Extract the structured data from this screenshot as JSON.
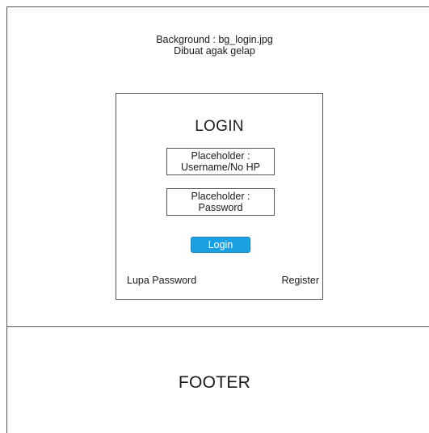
{
  "background_note": {
    "line1": "Background : bg_login.jpg",
    "line2": "Dibuat agak gelap"
  },
  "login": {
    "title": "LOGIN",
    "username_field": {
      "line1": "Placeholder :",
      "line2": "Username/No HP"
    },
    "password_field": {
      "line1": "Placeholder :",
      "line2": "Password"
    },
    "button_label": "Login",
    "button_color": "#1ba1e2",
    "forgot_password_label": "Lupa Password",
    "register_label": "Register"
  },
  "footer": {
    "label": "FOOTER"
  }
}
